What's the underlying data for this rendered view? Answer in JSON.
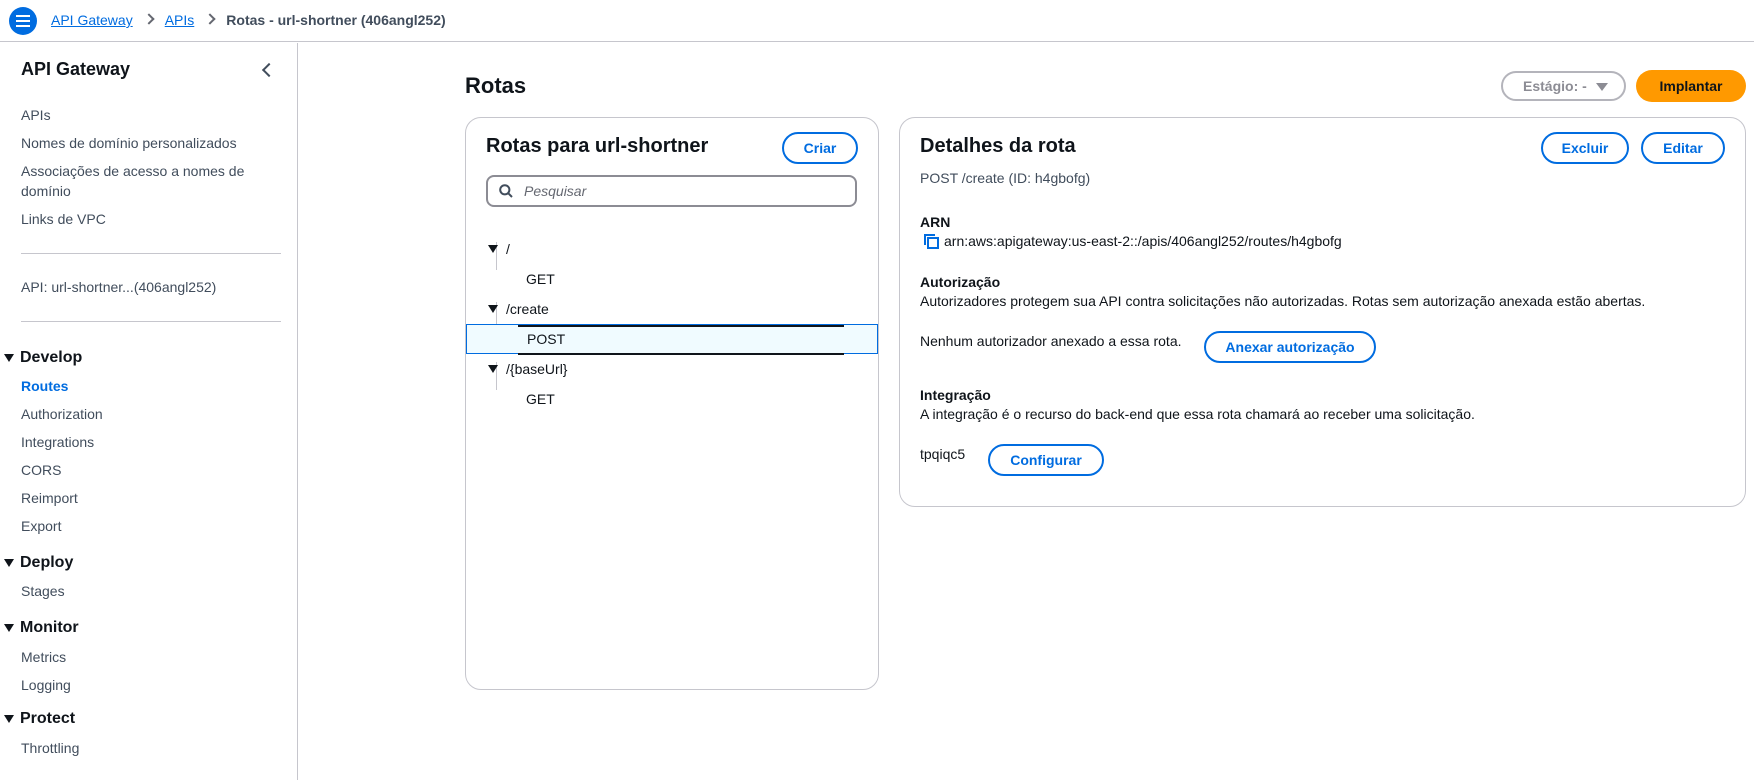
{
  "breadcrumbs": {
    "item1": "API Gateway",
    "item2": "APIs",
    "current": "Rotas - url-shortner (406angl252)"
  },
  "sidebar": {
    "title": "API Gateway",
    "links": {
      "apis": "APIs",
      "custom_domains": "Nomes de domínio personalizados",
      "domain_access": "Associações de acesso a nomes de domínio",
      "vpc_links": "Links de VPC"
    },
    "api_name": "API: url-shortner...(406angl252)",
    "sections": {
      "develop": "Develop",
      "deploy": "Deploy",
      "monitor": "Monitor",
      "protect": "Protect"
    },
    "develop_items": {
      "routes": "Routes",
      "authorization": "Authorization",
      "integrations": "Integrations",
      "cors": "CORS",
      "reimport": "Reimport",
      "export": "Export"
    },
    "deploy_items": {
      "stages": "Stages"
    },
    "monitor_items": {
      "metrics": "Metrics",
      "logging": "Logging"
    },
    "protect_items": {
      "throttling": "Throttling"
    }
  },
  "main": {
    "title": "Rotas",
    "stage_select": "Estágio: -",
    "deploy_label": "Implantar"
  },
  "routes_panel": {
    "title": "Rotas para url-shortner",
    "create_label": "Criar",
    "search_placeholder": "Pesquisar",
    "tree": {
      "root": "/",
      "root_get": "GET",
      "create": "/create",
      "create_post": "POST",
      "baseurl": "/{baseUrl}",
      "baseurl_get": "GET"
    }
  },
  "details_panel": {
    "title": "Detalhes da rota",
    "delete_label": "Excluir",
    "edit_label": "Editar",
    "route_id": "POST /create (ID: h4gbofg)",
    "arn_label": "ARN",
    "arn_value": "arn:aws:apigateway:us-east-2::/apis/406angl252/routes/h4gbofg",
    "auth_label": "Autorização",
    "auth_desc": "Autorizadores protegem sua API contra solicitações não autorizadas. Rotas sem autorização anexada estão abertas.",
    "auth_none": "Nenhum autorizador anexado a essa rota.",
    "attach_auth_label": "Anexar autorização",
    "integration_label": "Integração",
    "integration_desc": "A integração é o recurso do back-end que essa rota chamará ao receber uma solicitação.",
    "integration_id": "tpqiqc5",
    "configure_label": "Configurar"
  },
  "colors": {
    "accent": "#006ce0",
    "deploy_button": "#ff9900",
    "selected_row_bg": "#f0fbff"
  }
}
